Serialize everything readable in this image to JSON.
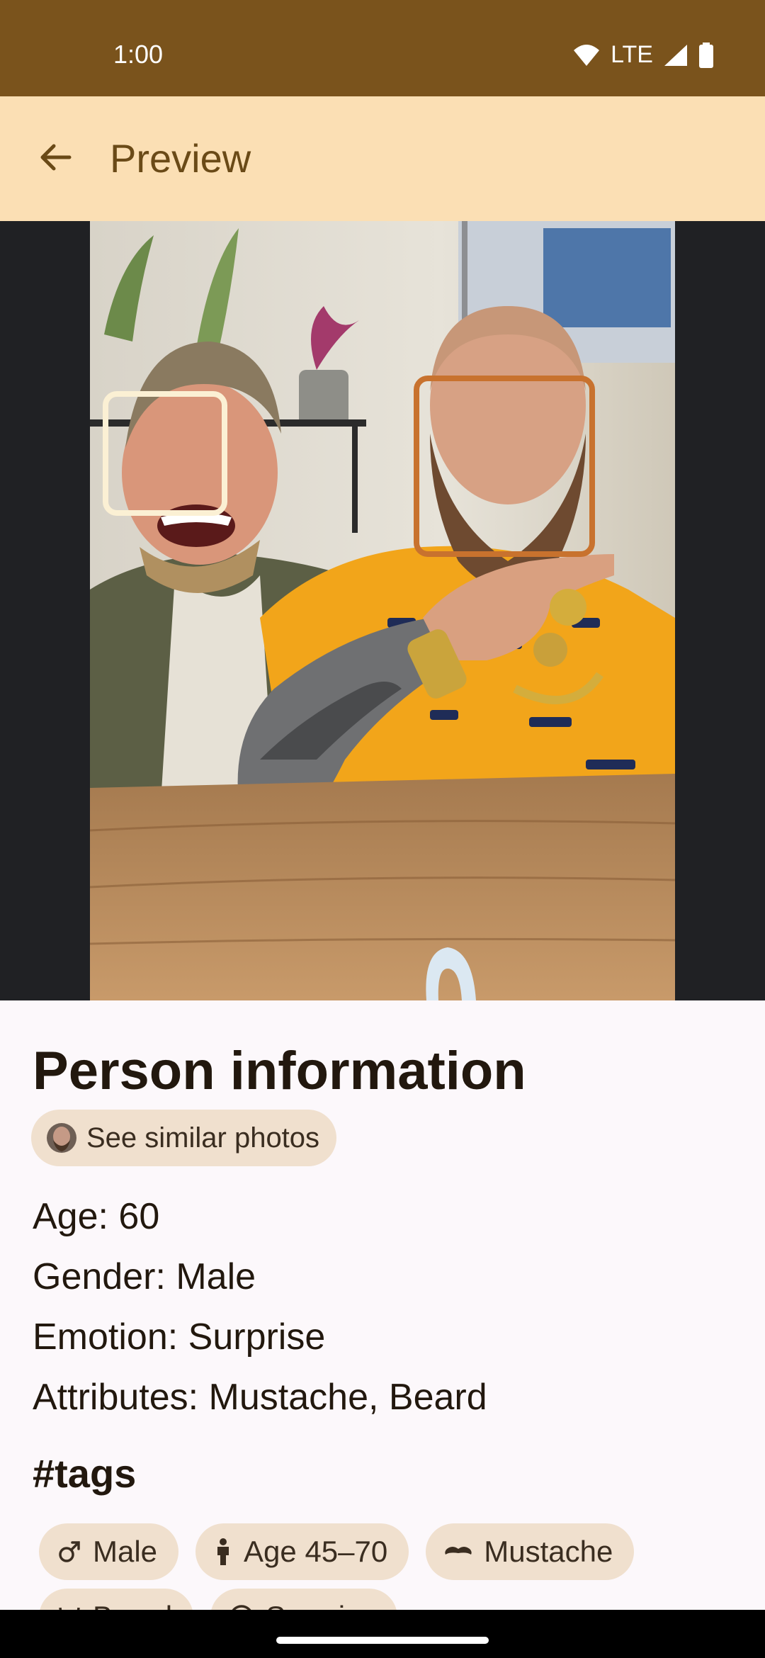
{
  "status_bar": {
    "time": "1:00",
    "network": "LTE",
    "icons": [
      "wifi-icon",
      "cellular-signal-icon",
      "battery-icon"
    ]
  },
  "app_bar": {
    "title": "Preview",
    "back_icon": "arrow-back-icon"
  },
  "photo": {
    "description_icon": "photo",
    "faces": [
      {
        "label": "face-1",
        "color": "#fbf0d4"
      },
      {
        "label": "face-2",
        "color": "#c8722e"
      }
    ]
  },
  "person": {
    "title": "Person information",
    "similar_button": "See similar photos",
    "age": "Age: 60",
    "gender": "Gender: Male",
    "emotion": "Emotion: Surprise",
    "attributes": "Attributes: Mustache, Beard"
  },
  "tags": {
    "title": "#tags",
    "row1": [
      {
        "icon": "male-icon",
        "label": "Male"
      },
      {
        "icon": "person-icon",
        "label": "Age 45–70"
      },
      {
        "icon": "mustache-icon",
        "label": "Mustache"
      }
    ],
    "row2": [
      {
        "icon": "beard-icon",
        "label": "Beard"
      },
      {
        "icon": "surprise-icon",
        "label": "Surprise"
      }
    ]
  },
  "colors": {
    "status_bar": "#7a531c",
    "app_bar": "#fbdfb4",
    "accent_text": "#6a4a17",
    "chip": "#f0e0ce"
  }
}
